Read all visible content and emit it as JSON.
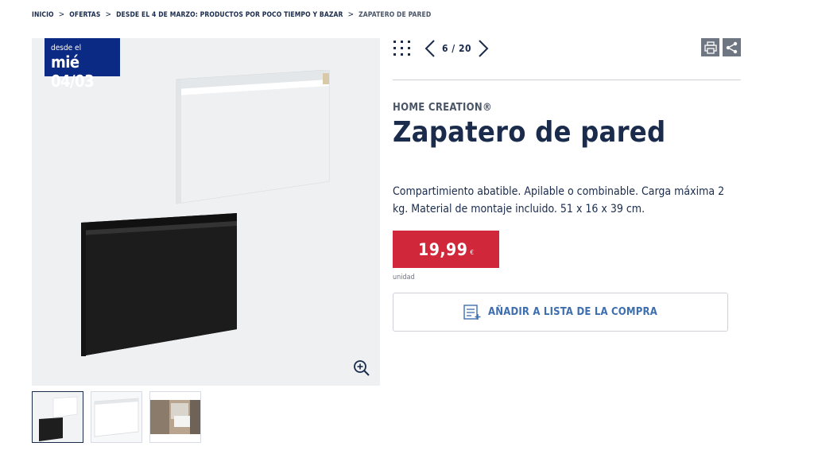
{
  "breadcrumb": {
    "items": [
      "INICIO",
      "OFERTAS",
      "DESDE EL 4 DE MARZO: PRODUCTOS POR POCO TIEMPO Y BAZAR",
      "ZAPATERO DE PARED"
    ],
    "separator": ">"
  },
  "badge": {
    "line1": "desde el",
    "line2": "mié 04/03"
  },
  "pager": {
    "text": "6 / 20"
  },
  "product": {
    "brand": "HOME CREATION®",
    "title": "Zapatero de pared",
    "description": "Compartimiento abatible. Apilable o combinable. Carga máxima 2 kg. Material de montaje incluido. 51 x 16 x 39 cm.",
    "price": "19,99",
    "currency": "€",
    "unit": "unidad"
  },
  "actions": {
    "add_to_list": "AÑADIR A LISTA DE LA COMPRA"
  },
  "icons": {
    "grid": "grid-icon",
    "prev": "chevron-left-icon",
    "next": "chevron-right-icon",
    "print": "print-icon",
    "share": "share-icon",
    "zoom": "zoom-in-icon",
    "list": "shopping-list-icon"
  },
  "colors": {
    "brand_navy": "#1a2b4c",
    "badge_blue": "#0b2a83",
    "price_red": "#d0283a",
    "link_blue": "#3d6eb0"
  }
}
